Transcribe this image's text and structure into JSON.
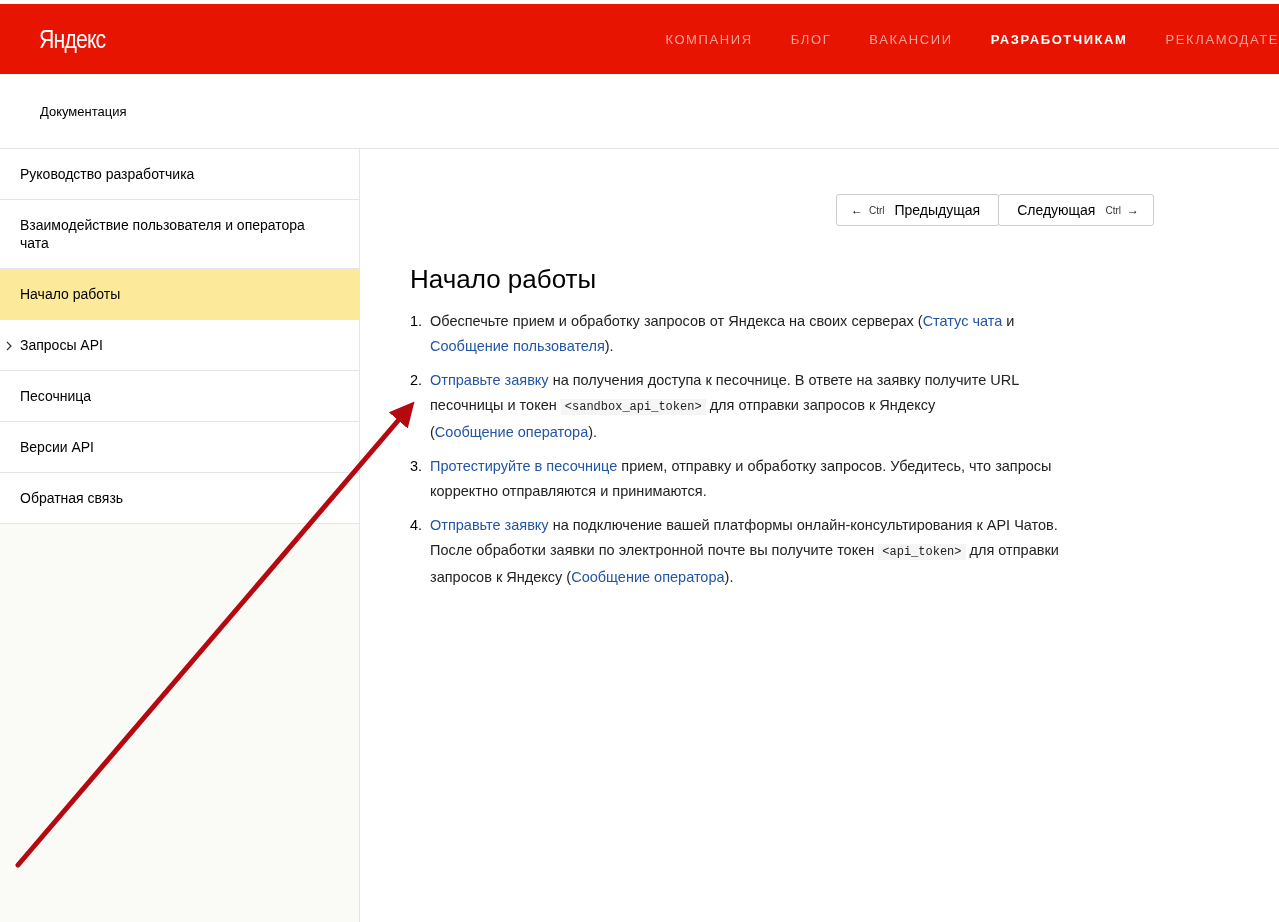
{
  "header": {
    "logo": "Яндекс",
    "nav": [
      {
        "label": "КОМПАНИЯ",
        "selected": false
      },
      {
        "label": "БЛОГ",
        "selected": false
      },
      {
        "label": "ВАКАНСИИ",
        "selected": false
      },
      {
        "label": "РАЗРАБОТЧИКАМ",
        "selected": true
      },
      {
        "label": "РЕКЛАМОДАТЕ",
        "selected": false
      }
    ]
  },
  "breadcrumb": "Документация",
  "sidebar": {
    "items": [
      {
        "label": "Руководство разработчика",
        "kind": "page",
        "selected": false
      },
      {
        "label": "Взаимодействие пользователя и оператора чата",
        "kind": "page",
        "selected": false
      },
      {
        "label": "Начало работы",
        "kind": "page",
        "selected": true
      },
      {
        "label": "Запросы API",
        "kind": "group",
        "selected": false
      },
      {
        "label": "Песочница",
        "kind": "page",
        "selected": false
      },
      {
        "label": "Версии API",
        "kind": "page",
        "selected": false
      },
      {
        "label": "Обратная связь",
        "kind": "page",
        "selected": false
      }
    ]
  },
  "pager": {
    "previous": {
      "arrow": "←",
      "key": "Ctrl",
      "label": "Предыдущая"
    },
    "next": {
      "label": "Следующая",
      "key": "Ctrl",
      "arrow": "→"
    }
  },
  "article": {
    "title": "Начало работы",
    "steps": [
      {
        "number": "1.",
        "parts": [
          {
            "kind": "text",
            "text": "Обеспечьте прием и обработку запросов от Яндекса на своих серверах ("
          },
          {
            "kind": "link",
            "text": "Статус чата"
          },
          {
            "kind": "text",
            "text": " и "
          },
          {
            "kind": "link",
            "text": "Сообщение пользователя"
          },
          {
            "kind": "text",
            "text": ")."
          }
        ]
      },
      {
        "number": "2.",
        "parts": [
          {
            "kind": "link",
            "text": "Отправьте заявку"
          },
          {
            "kind": "text",
            "text": " на получения доступа к песочнице. В ответе на заявку получите URL песочницы и токен "
          },
          {
            "kind": "code",
            "text": "<sandbox_api_token>"
          },
          {
            "kind": "text",
            "text": " для отправки запросов к Яндексу ("
          },
          {
            "kind": "link",
            "text": "Сообщение оператора"
          },
          {
            "kind": "text",
            "text": ")."
          }
        ]
      },
      {
        "number": "3.",
        "parts": [
          {
            "kind": "link",
            "text": "Протестируйте в песочнице"
          },
          {
            "kind": "text",
            "text": " прием, отправку и обработку запросов. Убедитесь, что запросы корректно отправляются и принимаются."
          }
        ]
      },
      {
        "number": "4.",
        "parts": [
          {
            "kind": "link",
            "text": "Отправьте заявку"
          },
          {
            "kind": "text",
            "text": " на подключение вашей платформы онлайн-консультирования к API Чатов. После обработки заявки по электронной почте вы получите токен "
          },
          {
            "kind": "code",
            "text": "<api_token>"
          },
          {
            "kind": "text",
            "text": " для отправки запросов к Яндексу ("
          },
          {
            "kind": "link",
            "text": "Сообщение оператора"
          },
          {
            "kind": "text",
            "text": ")."
          }
        ]
      }
    ]
  }
}
